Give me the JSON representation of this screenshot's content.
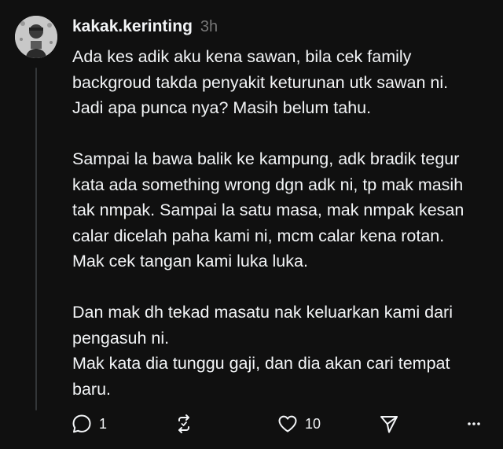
{
  "post": {
    "username": "kakak.kerinting",
    "time": "3h",
    "paragraphs": [
      [
        "Ada kes adik aku kena sawan, bila cek family",
        "backgroud takda penyakit keturunan utk sawan ni.",
        "Jadi apa punca nya? Masih belum tahu."
      ],
      [
        "Sampai la bawa balik ke kampung, adk bradik tegur",
        "kata ada something wrong dgn adk ni, tp mak masih",
        "tak nmpak. Sampai la satu masa, mak nmpak kesan",
        "calar dicelah paha kami ni, mcm calar kena rotan.",
        "Mak cek tangan kami luka luka."
      ],
      [
        "Dan mak dh tekad masatu nak keluarkan kami dari",
        "pengasuh ni.",
        "Mak kata dia tunggu gaji, dan dia akan cari tempat",
        "baru."
      ]
    ]
  },
  "actions": {
    "reply_icon": "comment-bubble-icon",
    "reply_count": "1",
    "repost_icon": "repost-arrows-icon",
    "like_icon": "heart-icon",
    "like_count": "10",
    "share_icon": "paper-plane-icon",
    "more_icon": "ellipsis-icon"
  },
  "colors": {
    "background": "#101010",
    "text": "#f3f5f7",
    "muted": "#777777",
    "thread_line": "#333638"
  }
}
